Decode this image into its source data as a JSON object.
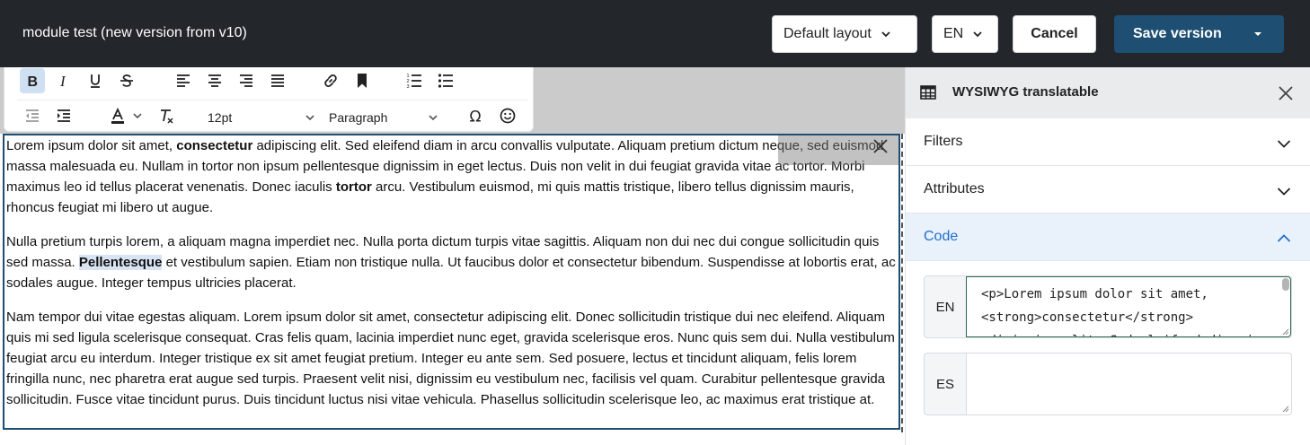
{
  "header": {
    "title": "module test (new version from v10)",
    "layout_select": "Default layout",
    "lang_select": "EN",
    "cancel_label": "Cancel",
    "save_label": "Save version"
  },
  "toolbar": {
    "font_size": "12pt",
    "block_format": "Paragraph"
  },
  "editor": {
    "p1": {
      "t1": "Lorem ipsum dolor sit amet, ",
      "b1": "consectetur",
      "t2": " adipiscing elit. Sed eleifend diam in arcu convallis vulputate. Aliquam pretium dictum neque, sed euismod massa malesuada eu. Nullam in tortor non ipsum pellentesque dignissim in eget lectus. Duis non velit in dui feugiat gravida vitae ac tortor. Morbi maximus leo id tellus placerat venenatis. Donec iaculis ",
      "b2": "tortor",
      "t3": " arcu. Vestibulum euismod, mi quis mattis tristique, libero tellus dignissim mauris, rhoncus feugiat mi libero ut augue."
    },
    "p2": {
      "t1": "Nulla pretium turpis lorem, a aliquam magna imperdiet nec. Nulla porta dictum turpis vitae sagittis. Aliquam non dui nec dui congue sollicitudin quis sed massa. ",
      "b1": "Pellentesque",
      "t2": " et vestibulum sapien. Etiam non tristique nulla. Ut faucibus dolor et consectetur bibendum. Suspendisse at lobortis erat, ac sodales augue. Integer tempus ultricies placerat."
    },
    "p3": "Nam tempor dui vitae egestas aliquam. Lorem ipsum dolor sit amet, consectetur adipiscing elit. Donec sollicitudin tristique dui nec eleifend. Aliquam quis mi sed ligula scelerisque consequat. Cras felis quam, lacinia imperdiet nunc eget, gravida scelerisque eros. Nunc quis sem dui. Nulla vestibulum feugiat arcu eu interdum. Integer tristique ex sit amet feugiat pretium. Integer eu ante sem. Sed posuere, lectus et tincidunt aliquam, felis lorem fringilla nunc, nec pharetra erat augue sed turpis. Praesent velit nisi, dignissim eu vestibulum nec, facilisis vel quam. Curabitur pellentesque gravida sollicitudin. Fusce vitae tincidunt purus. Duis tincidunt luctus nisi vitae vehicula. Phasellus sollicitudin scelerisque leo, ac maximus erat tristique at."
  },
  "panel": {
    "title": "WYSIWYG translatable",
    "sections": [
      "Filters",
      "Attributes",
      "Code"
    ],
    "fields": [
      {
        "lang": "EN",
        "value": "<p>Lorem ipsum dolor sit amet,\n<strong>consectetur</strong>\nadipiscing elit. Sed eleifend diam in"
      },
      {
        "lang": "ES",
        "value": ""
      }
    ]
  },
  "colors": {
    "topbar": "#23262b",
    "save": "#1e4f73",
    "accent": "#1f6fc9"
  },
  "icons": [
    "bold-icon",
    "italic-icon",
    "underline-icon",
    "strikethrough-icon",
    "align-left-icon",
    "align-center-icon",
    "align-right-icon",
    "align-justify-icon",
    "link-icon",
    "bookmark-icon",
    "numbered-list-icon",
    "bullet-list-icon",
    "outdent-icon",
    "indent-icon",
    "text-color-icon",
    "clear-format-icon",
    "omega-icon",
    "emoji-icon",
    "table-icon",
    "close-icon",
    "chevron-down-icon",
    "chevron-up-icon"
  ]
}
